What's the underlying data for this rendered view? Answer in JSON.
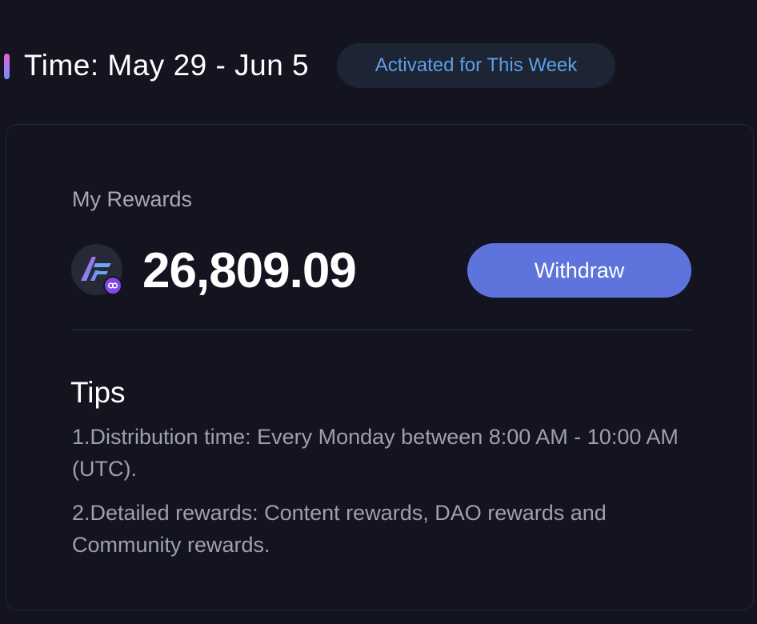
{
  "header": {
    "time_label": "Time: May 29 - Jun 5",
    "badge": "Activated for This Week"
  },
  "rewards": {
    "label": "My Rewards",
    "amount": "26,809.09",
    "token_icon": "token-logo-icon",
    "chain_icon": "polygon-chain-icon",
    "withdraw_label": "Withdraw"
  },
  "tips": {
    "title": "Tips",
    "items": [
      "1.Distribution time: Every Monday between 8:00 AM - 10:00 AM (UTC).",
      "2.Detailed rewards: Content rewards, DAO rewards and Community rewards."
    ]
  },
  "colors": {
    "background": "#13141f",
    "badge_text": "#5e9fe8",
    "badge_bg": "#1d2434",
    "button": "#5f73dd",
    "accent_gradient_start": "#e85fd0",
    "accent_gradient_end": "#6c8ff5"
  }
}
